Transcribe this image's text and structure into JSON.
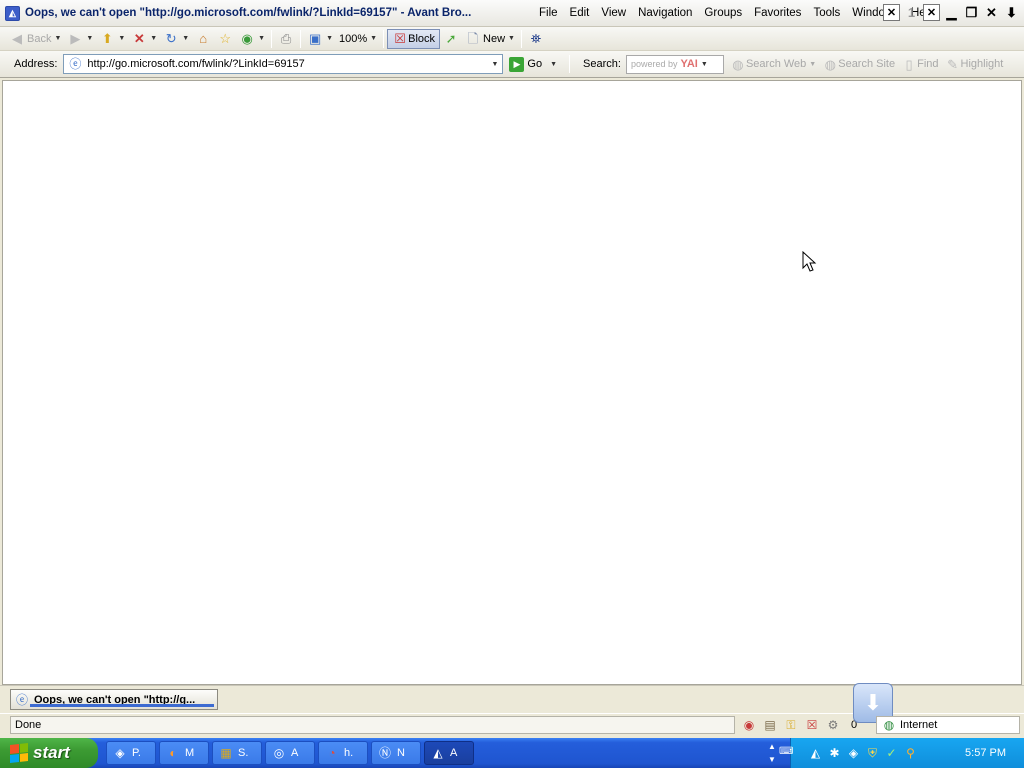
{
  "window": {
    "title": "Oops, we can't open \"http://go.microsoft.com/fwlink/?LinkId=69157\" - Avant Bro...",
    "menus": [
      "File",
      "Edit",
      "View",
      "Navigation",
      "Groups",
      "Favorites",
      "Tools",
      "Windows",
      "Help"
    ],
    "controls": {
      "counter": "1"
    }
  },
  "toolbar": {
    "back_label": "Back",
    "zoom_label": "100%",
    "block_label": "Block",
    "new_label": "New"
  },
  "address": {
    "label": "Address:",
    "url": "http://go.microsoft.com/fwlink/?LinkId=69157",
    "go_label": "Go"
  },
  "search": {
    "label": "Search:",
    "placeholder_powered": "powered by",
    "provider": "YAI",
    "web_label": "Search Web",
    "site_label": "Search Site",
    "find_label": "Find",
    "highlight_label": "Highlight"
  },
  "tabs": [
    {
      "label": "Oops, we can't open \"http://g..."
    }
  ],
  "status": {
    "text": "Done",
    "popup_count": "0",
    "zone": "Internet"
  },
  "taskbar": {
    "start_label": "start",
    "tasks": [
      {
        "label": "P.",
        "icon": "app-icon"
      },
      {
        "label": "M",
        "icon": "firefox-icon"
      },
      {
        "label": "S.",
        "icon": "app-icon"
      },
      {
        "label": "A",
        "icon": "app-icon"
      },
      {
        "label": "h.",
        "icon": "app-icon"
      },
      {
        "label": "N",
        "icon": "app-icon"
      },
      {
        "label": "A",
        "icon": "avant-icon"
      }
    ],
    "clock": "5:57 PM"
  }
}
